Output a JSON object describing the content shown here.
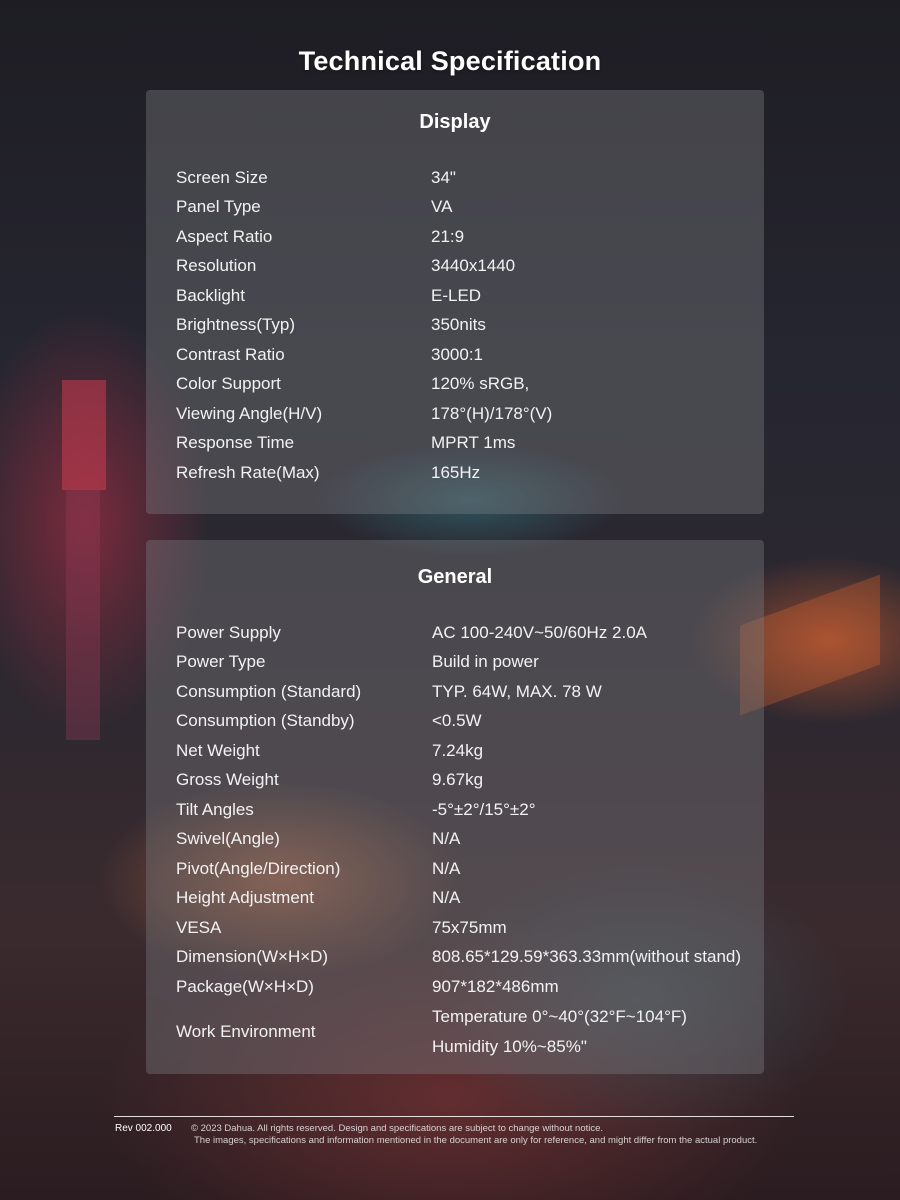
{
  "title": "Technical Specification",
  "display": {
    "heading": "Display",
    "rows": [
      {
        "label": "Screen Size",
        "value": "34\""
      },
      {
        "label": "Panel Type",
        "value": "VA"
      },
      {
        "label": "Aspect Ratio",
        "value": "21:9"
      },
      {
        "label": "Resolution",
        "value": "3440x1440"
      },
      {
        "label": "Backlight",
        "value": "E-LED"
      },
      {
        "label": "Brightness(Typ)",
        "value": "350nits"
      },
      {
        "label": "Contrast Ratio",
        "value": "3000:1"
      },
      {
        "label": "Color Support",
        "value": "120% sRGB,"
      },
      {
        "label": "Viewing Angle(H/V)",
        "value": "178°(H)/178°(V)"
      },
      {
        "label": "Response Time",
        "value": "MPRT 1ms"
      },
      {
        "label": "Refresh Rate(Max)",
        "value": "165Hz"
      }
    ]
  },
  "general": {
    "heading": "General",
    "rows": [
      {
        "label": "Power Supply",
        "value": "AC 100-240V~50/60Hz 2.0A"
      },
      {
        "label": "Power Type",
        "value": "Build in power"
      },
      {
        "label": "Consumption (Standard)",
        "value": "TYP. 64W, MAX. 78 W"
      },
      {
        "label": "Consumption (Standby)",
        "value": "<0.5W"
      },
      {
        "label": "Net Weight",
        "value": "7.24kg"
      },
      {
        "label": "Gross Weight",
        "value": "9.67kg"
      },
      {
        "label": "Tilt Angles",
        "value": "-5°±2°/15°±2°"
      },
      {
        "label": "Swivel(Angle)",
        "value": "N/A"
      },
      {
        "label": "Pivot(Angle/Direction)",
        "value": "N/A"
      },
      {
        "label": "Height Adjustment",
        "value": "N/A"
      },
      {
        "label": "VESA",
        "value": "75x75mm"
      },
      {
        "label": "Dimension(W×H×D)",
        "value": "808.65*129.59*363.33mm(without stand)"
      },
      {
        "label": "Package(W×H×D)",
        "value": "907*182*486mm"
      }
    ],
    "work_environment": {
      "label": "Work Environment",
      "line1": "Temperature 0°~40°(32°F~104°F)",
      "line2": "Humidity 10%~85%\""
    }
  },
  "footer": {
    "rev": "Rev 002.000",
    "legal_line1": "© 2023 Dahua. All rights reserved. Design and specifications are subject to change without notice.",
    "legal_line2": "The images, specifications and information mentioned in the document are only for reference, and might differ from the actual product."
  }
}
